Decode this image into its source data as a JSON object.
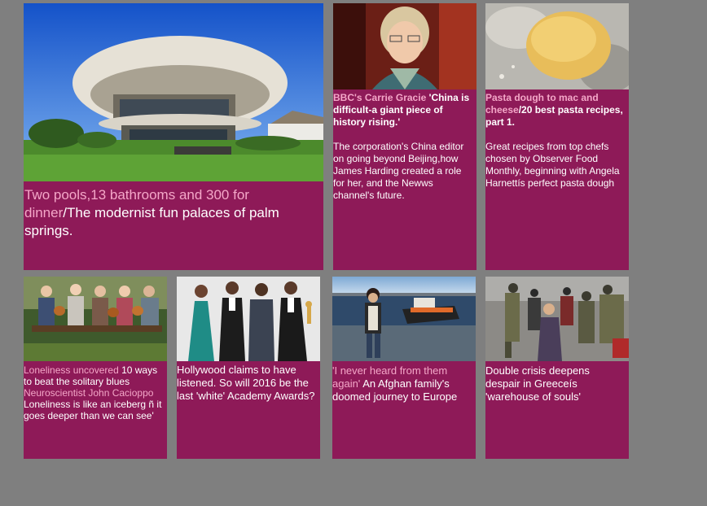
{
  "cards": {
    "big": {
      "image": "modernist-house-photo",
      "kicker": "Two pools,13 bathrooms and 300 for dinner",
      "headline": "/The modernist fun palaces of palm springs."
    },
    "gracie": {
      "image": "carrie-gracie-portrait",
      "kicker": "BBC's Carrie Gracie",
      "headline": " 'China is difficult-a giant piece of history rising.'",
      "body": "The corporation's China editor on going beyond Beijing,how James Harding created a role for her, and the Newws channel's future."
    },
    "pasta": {
      "image": "pasta-dough-photo",
      "kicker": "Pasta dough to mac and cheese",
      "headline": "/20 best pasta recipes, part 1.",
      "body": "Great recipes from top chefs chosen by Observer Food Monthly, beginning with Angela Harnettís perfect pasta dough"
    },
    "lonely": {
      "image": "seniors-on-bench-photo",
      "kicker": "Loneliness uncovered",
      "headline": " 10 ways to beat the solitary blues ",
      "kicker2": "Neuroscientist John Cacioppo",
      "body": "Loneliness is like an iceberg ñ it goes deeper than we can see'"
    },
    "holly": {
      "image": "hollywood-actors-photo",
      "headline": "Hollywood claims to have listened. So will 2016 be the last 'white' Academy Awards?"
    },
    "afghan": {
      "image": "boy-at-harbour-photo",
      "kicker": "'I never heard from them again'",
      "headline": " An Afghan family's doomed journey to Europe"
    },
    "greece": {
      "image": "refugee-crowd-photo",
      "headline": "Double crisis deepens despair in Greeceís 'warehouse of souls'"
    }
  },
  "colors": {
    "page_bg": "#7f7f7f",
    "card_bg": "#8e1a58",
    "kicker": "#f4a7c8",
    "text": "#ffffff"
  }
}
